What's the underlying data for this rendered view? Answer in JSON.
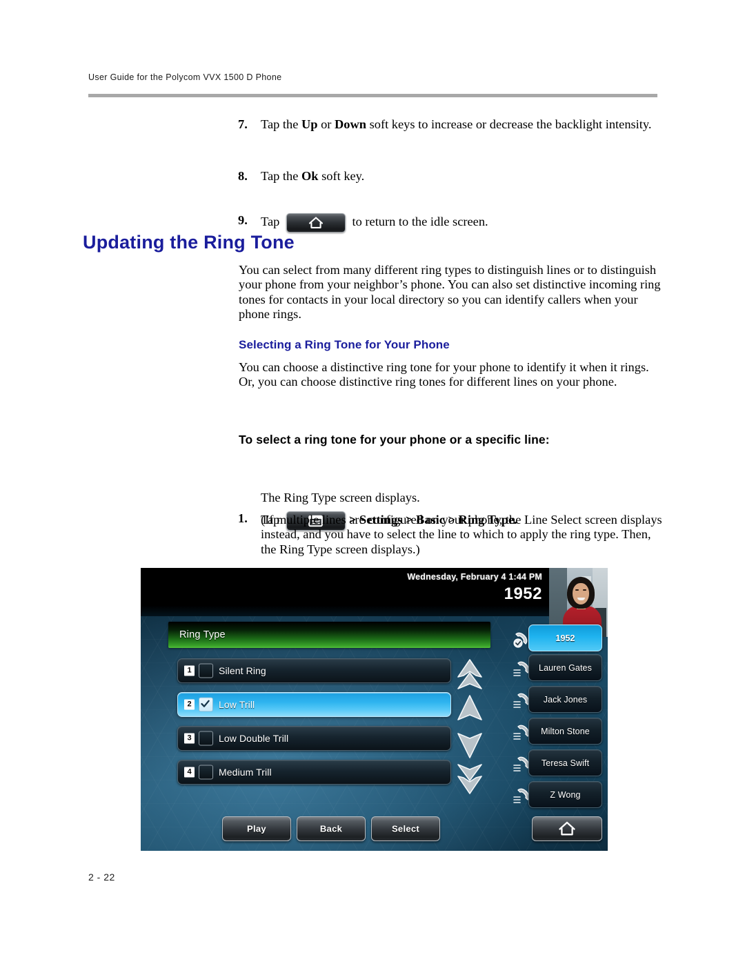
{
  "header": {
    "running_head": "User Guide for the Polycom VVX 1500 D Phone"
  },
  "footer": {
    "page_number": "2 - 22"
  },
  "steps_top": [
    {
      "num": "7.",
      "text_before": "Tap the ",
      "bold_1": "Up",
      "text_mid": " or ",
      "bold_2": "Down",
      "text_after": " soft keys to increase or decrease the backlight intensity."
    },
    {
      "num": "8.",
      "text_before": "Tap the ",
      "bold_1": "Ok",
      "text_after": " soft key."
    },
    {
      "num": "9.",
      "text_before": "Tap ",
      "icon": "home-icon",
      "text_after": " to return to the idle screen."
    }
  ],
  "section": {
    "title": "Updating the Ring Tone",
    "intro": "You can select from many different ring types to distinguish lines or to distinguish your phone from your neighbor’s phone. You can also set distinctive incoming ring tones for contacts in your local directory so you can identify callers when your phone rings.",
    "subsection_title": "Selecting a Ring Tone for Your Phone",
    "subsection_intro": "You can choose a distinctive ring tone for your phone to identify it when it rings. Or, you can choose distinctive ring tones for different lines on your phone.",
    "procedure_title": "To select a ring tone for your phone or a specific line:",
    "step1_num": "1.",
    "step1_before": "Tap ",
    "step1_icon": "menu-icon",
    "step1_path": "> Settings > Basic > Ring Type.",
    "step1_result": "The Ring Type screen displays.",
    "step1_note": "(If multiple lines are configured on your phone, the Line Select screen displays instead, and you have to select the line to which to apply the ring type. Then, the Ring Type screen displays.)"
  },
  "phone_screen": {
    "status_date": "Wednesday, February 4  1:44 PM",
    "status_extension": "1952",
    "screen_title": "Ring Type",
    "ring_types": [
      {
        "index": "1",
        "label": "Silent Ring",
        "checked": false
      },
      {
        "index": "2",
        "label": "Low Trill",
        "checked": true
      },
      {
        "index": "3",
        "label": "Low Double Trill",
        "checked": false
      },
      {
        "index": "4",
        "label": "Medium Trill",
        "checked": false
      }
    ],
    "scroll_arrows": [
      "page-up-icon",
      "up-icon",
      "down-icon",
      "page-down-icon"
    ],
    "line_keys": [
      {
        "label": "1952",
        "active": true
      },
      {
        "label": "Lauren Gates",
        "active": false
      },
      {
        "label": "Jack Jones",
        "active": false
      },
      {
        "label": "Milton Stone",
        "active": false
      },
      {
        "label": "Teresa Swift",
        "active": false
      },
      {
        "label": "Z Wong",
        "active": false
      }
    ],
    "soft_keys": [
      {
        "label": "Play"
      },
      {
        "label": "Back"
      },
      {
        "label": "Select"
      }
    ],
    "home_key_icon": "home-icon",
    "colors": {
      "heading_blue": "#1a1d9c",
      "selected_blue": "#2fb4ef",
      "title_green": "#3aa32a"
    }
  }
}
